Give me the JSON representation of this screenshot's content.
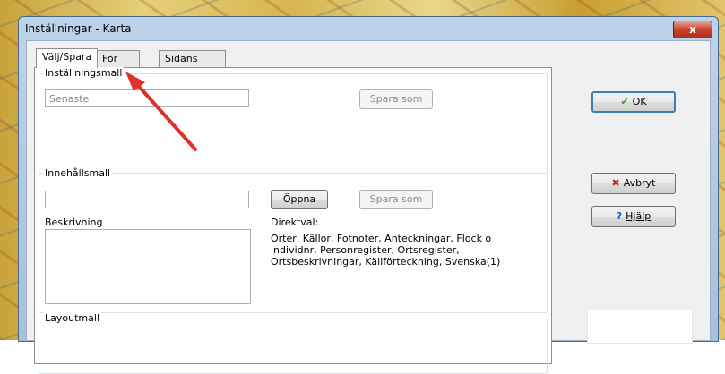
{
  "window": {
    "title": "Inställningar - Karta",
    "close_glyph": "x"
  },
  "tabs": [
    {
      "label": "Välj/Spara",
      "active": true
    },
    {
      "label": "För kartan",
      "active": false
    },
    {
      "label": "Sidans utformning",
      "active": false
    }
  ],
  "settings_template": {
    "group_title": "Inställningsmall",
    "input_value": "Senaste",
    "save_as_label": "Spara som"
  },
  "content_template": {
    "group_title": "Innehållsmall",
    "input_value": "",
    "open_label": "Öppna",
    "save_as_label": "Spara som",
    "description_label": "Beskrivning",
    "direct_choice_label": "Direktval:",
    "direct_choice_lines": [
      "Orter, Källor, Fotnoter, Anteckningar, Flock o",
      "individnr, Personregister, Ortsregister,",
      "Ortsbeskrivningar, Källförteckning, Svenska(1)"
    ]
  },
  "layout_template": {
    "group_title": "Layoutmall"
  },
  "buttons": {
    "ok_label": "OK",
    "cancel_label": "Avbryt",
    "help_label": "Hjälp"
  },
  "icons": {
    "ok": "checkmark-icon",
    "cancel": "red-x-icon",
    "help": "question-icon"
  },
  "colors": {
    "accent_red": "#e0302a",
    "ok_check": "#2f9a1f",
    "help_blue": "#1f5fbf"
  }
}
